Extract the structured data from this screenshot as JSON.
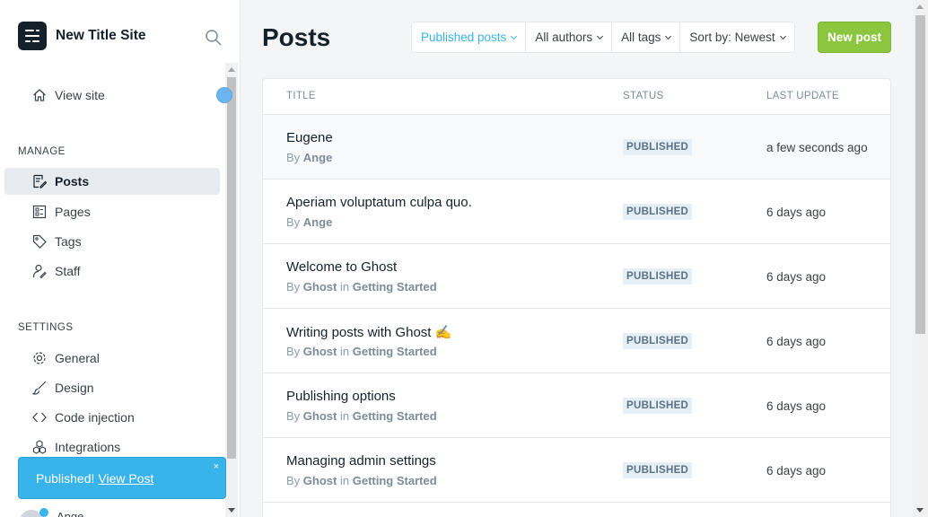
{
  "site": {
    "title": "New Title Site"
  },
  "sidebar": {
    "view_site": "View site",
    "manage_title": "MANAGE",
    "manage_items": [
      {
        "label": "Posts",
        "icon": "posts-icon",
        "active": true
      },
      {
        "label": "Pages",
        "icon": "pages-icon"
      },
      {
        "label": "Tags",
        "icon": "tag-icon"
      },
      {
        "label": "Staff",
        "icon": "staff-icon"
      }
    ],
    "settings_title": "SETTINGS",
    "settings_items": [
      {
        "label": "General",
        "icon": "gear-icon"
      },
      {
        "label": "Design",
        "icon": "brush-icon"
      },
      {
        "label": "Code injection",
        "icon": "code-icon"
      },
      {
        "label": "Integrations",
        "icon": "integrations-icon"
      }
    ],
    "user_name": "Ange"
  },
  "toast": {
    "text": "Published!",
    "link": "View Post",
    "close": "×"
  },
  "header": {
    "title": "Posts",
    "filters": [
      "Published posts",
      "All authors",
      "All tags",
      "Sort by: Newest"
    ],
    "new_post": "New post"
  },
  "table": {
    "columns": [
      "TITLE",
      "STATUS",
      "LAST UPDATE"
    ],
    "rows": [
      {
        "title": "Eugene",
        "by": "By",
        "author": "Ange",
        "in": "",
        "tag": "",
        "status": "PUBLISHED",
        "updated": "a few seconds ago"
      },
      {
        "title": "Aperiam voluptatum culpa quo.",
        "by": "By",
        "author": "Ange",
        "in": "",
        "tag": "",
        "status": "PUBLISHED",
        "updated": "6 days ago"
      },
      {
        "title": "Welcome to Ghost",
        "by": "By",
        "author": "Ghost",
        "in": "in",
        "tag": "Getting Started",
        "status": "PUBLISHED",
        "updated": "6 days ago"
      },
      {
        "title": "Writing posts with Ghost ✍️",
        "by": "By",
        "author": "Ghost",
        "in": "in",
        "tag": "Getting Started",
        "status": "PUBLISHED",
        "updated": "6 days ago"
      },
      {
        "title": "Publishing options",
        "by": "By",
        "author": "Ghost",
        "in": "in",
        "tag": "Getting Started",
        "status": "PUBLISHED",
        "updated": "6 days ago"
      },
      {
        "title": "Managing admin settings",
        "by": "By",
        "author": "Ghost",
        "in": "in",
        "tag": "Getting Started",
        "status": "PUBLISHED",
        "updated": "6 days ago"
      }
    ]
  },
  "colors": {
    "accent": "#39b4ea",
    "new_post": "#8cc63f",
    "sidebar_active": "#e7ebf0"
  }
}
